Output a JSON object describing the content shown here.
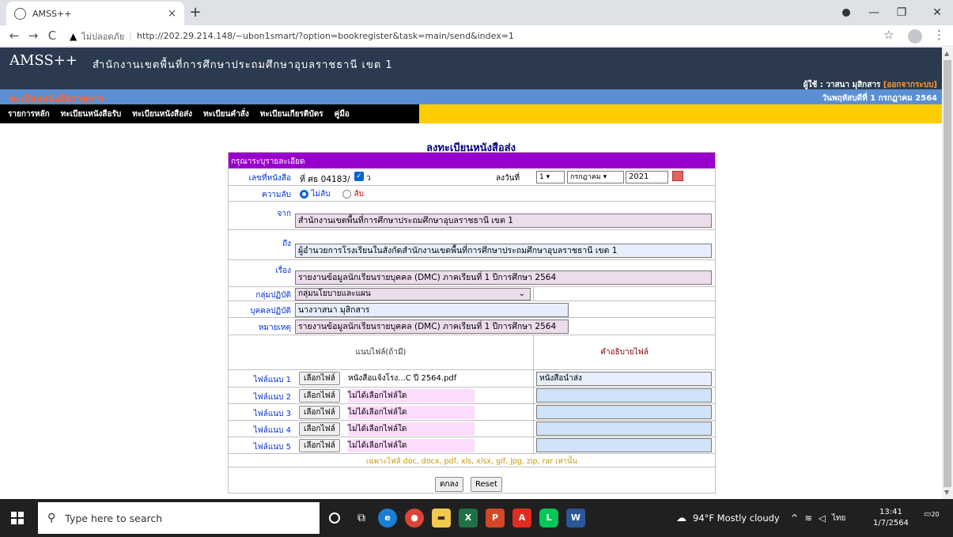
{
  "browser": {
    "tab_title": "AMSS++",
    "tab_close": "×",
    "new_tab": "+",
    "insecure_label": "ไม่ปลอดภัย",
    "url": "http://202.29.214.148/~ubon1smart/?option=bookregister&task=main/send&index=1"
  },
  "header": {
    "brand": "AMSS++",
    "office": "สำนักงานเขตพื้นที่การศึกษาประถมศึกษาอุบลราชธานี เขต 1",
    "user_label": "ผู้ใช้ : วาสนา มุสิกสาร",
    "logout": "[ออกจากระบบ]"
  },
  "subbar": {
    "title": "ทะเบียนหนังสือราชการ",
    "date": "วันพฤหัสบดีที่ 1 กรกฎาคม 2564"
  },
  "menu": [
    "รายการหลัก",
    "ทะเบียนหนังสือรับ",
    "ทะเบียนหนังสือส่ง",
    "ทะเบียนคำสั่ง",
    "ทะเบียนเกียรติบัตร",
    "คู่มือ"
  ],
  "form": {
    "title": "ลงทะเบียนหนังสือส่ง",
    "section": "กรุณาระบุรายละเอียด",
    "book_no_label": "เลขที่หนังสือ",
    "book_no_value": "ที่ ศธ 04183/",
    "book_no_suffix": "ว",
    "date_label": "ลงวันที่",
    "day": "1",
    "month": "กรกฎาคม",
    "year": "2021",
    "secret_label": "ความลับ",
    "not_secret": "ไม่ลับ",
    "secret": "ลับ",
    "from_label": "จาก",
    "from_value": "สำนักงานเขตพื้นที่การศึกษาประถมศึกษาอุบลราชธานี เขต 1",
    "to_label": "ถึง",
    "to_value": "ผู้อำนวยการโรงเรียนในสังกัดสำนักงานเขตพื้นที่การศึกษาประถมศึกษาอุบลราชธานี เขต 1",
    "subject_label": "เรื่อง",
    "subject_value": "รายงานข้อมูลนักเรียนรายบุคคล (DMC) ภาคเรียนที่ 1 ปีการศึกษา 2564",
    "group_label": "กลุ่มปฏิบัติ",
    "group_value": "กลุ่มนโยบายและแผน",
    "person_label": "บุคคลปฏิบัติ",
    "person_value": "นางวาสนา มุสิกสาร",
    "note_label": "หมายเหตุ",
    "note_value": "รายงานข้อมูลนักเรียนรายบุคคล (DMC) ภาคเรียนที่ 1 ปีการศึกษา 2564",
    "attach_header": "แนบไฟล์(ถ้ามี)",
    "desc_header": "คำอธิบายไฟล์",
    "file_button": "เลือกไฟล์",
    "files": [
      {
        "label": "ไฟล์แนบ 1",
        "name": "หนังสือแจ้งโรง...C ปี 2564.pdf",
        "desc": "หนังสือนำส่ง"
      },
      {
        "label": "ไฟล์แนบ 2",
        "name": "ไม่ได้เลือกไฟล์ใด",
        "desc": ""
      },
      {
        "label": "ไฟล์แนบ 3",
        "name": "ไม่ได้เลือกไฟล์ใด",
        "desc": ""
      },
      {
        "label": "ไฟล์แนบ 4",
        "name": "ไม่ได้เลือกไฟล์ใด",
        "desc": ""
      },
      {
        "label": "ไฟล์แนบ 5",
        "name": "ไม่ได้เลือกไฟล์ใด",
        "desc": ""
      }
    ],
    "file_note": "เฉพาะไฟล์ doc, docx, pdf, xls, xlsx, gif, jpg, zip, rar เท่านั้น",
    "submit": "ตกลง",
    "reset": "Reset"
  },
  "taskbar": {
    "search_placeholder": "Type here to search",
    "weather": "94°F  Mostly cloudy",
    "lang": "ไทย",
    "time": "13:41",
    "date": "1/7/2564",
    "notif_count": "20"
  },
  "colors": {
    "header": "#2b3a4e",
    "subbar": "#5a8fd3",
    "menu": "#ffcc00",
    "section": "#9900cc"
  }
}
